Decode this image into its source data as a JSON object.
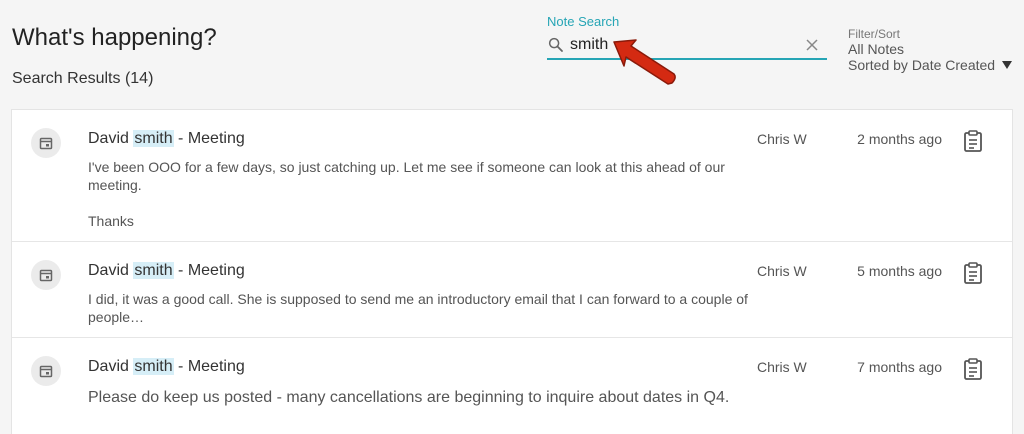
{
  "header": {
    "title": "What's happening?",
    "results_label": "Search Results (14)"
  },
  "search": {
    "label": "Note Search",
    "value": "smith",
    "accent_color": "#26a5b5"
  },
  "filter": {
    "label": "Filter/Sort",
    "filter_value": "All Notes",
    "sort_value": "Sorted by Date Created"
  },
  "notes": [
    {
      "title_prefix": "David",
      "title_highlight": "smith",
      "title_suffix": " - Meeting",
      "body_line1": "I've been OOO for a few days, so just catching up. Let me see if someone can look at this ahead of our",
      "body_line2": "meeting.",
      "body_line3": "Thanks",
      "author": "Chris W",
      "time": "2 months ago"
    },
    {
      "title_prefix": "David",
      "title_highlight": "smith",
      "title_suffix": " - Meeting",
      "body_line1": "I did, it was a good call. She is supposed to send me an introductory email that I can forward to a couple of",
      "body_line2": "people…",
      "author": "Chris W",
      "time": "5 months ago"
    },
    {
      "title_prefix": "David",
      "title_highlight": "smith",
      "title_suffix": " - Meeting",
      "body_line1": "Please do keep us posted - many cancellations are beginning to inquire about dates in Q4.",
      "author": "Chris W",
      "time": "7 months ago"
    }
  ],
  "icons": {
    "search": "search-icon",
    "clear": "close-icon",
    "sort_caret": "caret-down-icon",
    "note_type": "calendar-icon",
    "note_action": "clipboard-icon",
    "annotation": "red-arrow-annotation"
  },
  "colors": {
    "highlight": "#d6eef7",
    "arrow": "#d42a12"
  }
}
